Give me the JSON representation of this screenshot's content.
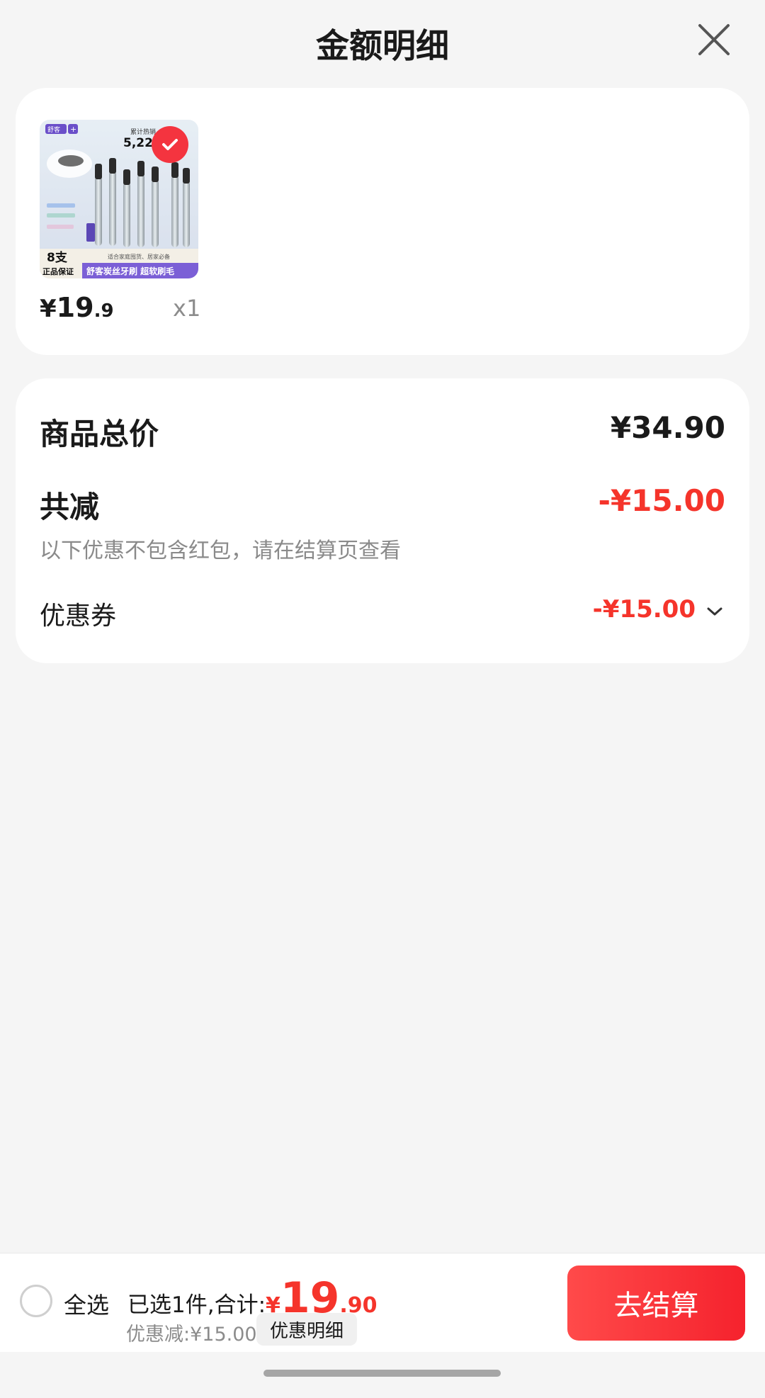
{
  "header": {
    "title": "金额明细"
  },
  "product": {
    "price_currency": "¥",
    "price_integer": "19",
    "price_decimal": ".9",
    "quantity": "x1",
    "selected": true,
    "image_text": {
      "brand": "舒客",
      "stat_label": "累计热销",
      "stat_value": "5,220",
      "count": "8支",
      "guarantee": "正品保证",
      "tagline": "适合家庭囤货、居家必备",
      "banner": "舒客炭丝牙刷 超软刷毛"
    }
  },
  "summary": {
    "total_label": "商品总价",
    "total_value": "¥34.90",
    "reduce_label": "共减",
    "reduce_value": "-¥15.00",
    "reduce_note": "以下优惠不包含红包，请在结算页查看",
    "coupon_label": "优惠券",
    "coupon_value": "-¥15.00"
  },
  "bottom_bar": {
    "select_all_label": "全选",
    "selected_text": "已选1件,合计:",
    "sum_currency": "¥",
    "sum_integer": "19",
    "sum_decimal": ".90",
    "discount_text": "优惠减:¥15.00",
    "detail_button": "优惠明细",
    "checkout_button": "去结算"
  },
  "colors": {
    "accent_red": "#f5342b",
    "background": "#f5f5f5",
    "card": "#ffffff"
  }
}
